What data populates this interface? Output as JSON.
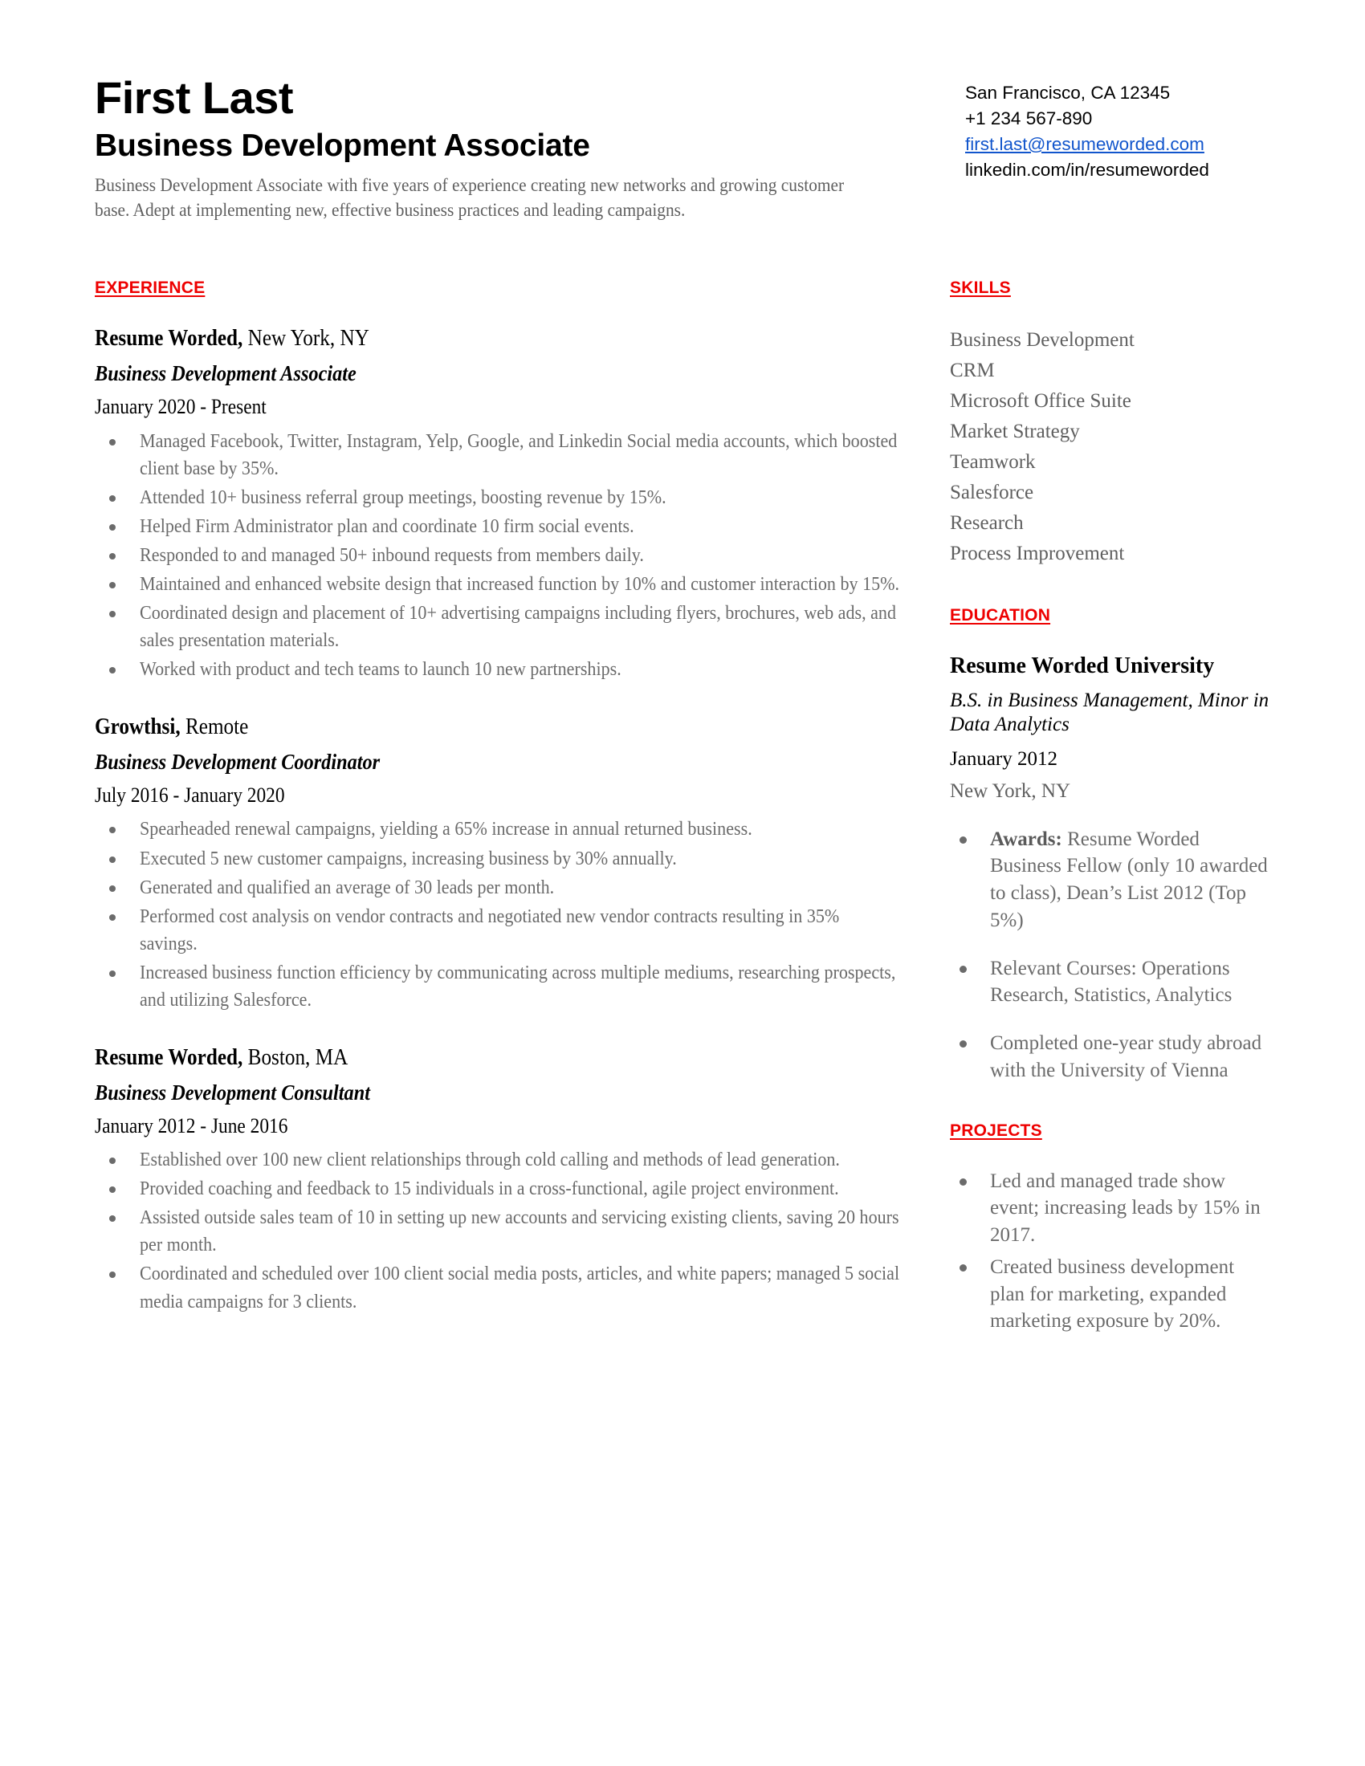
{
  "header": {
    "name": "First Last",
    "headline": "Business Development Associate",
    "summary": "Business Development Associate with five years of experience creating new networks and growing customer base. Adept at implementing new, effective business practices and leading campaigns.",
    "contact": {
      "location": "San Francisco, CA 12345",
      "phone": "+1 234 567-890",
      "email": "first.last@resumeworded.com",
      "linkedin": "linkedin.com/in/resumeworded"
    }
  },
  "colors": {
    "accent_red": "#ee0000",
    "link_blue": "#1155cc",
    "body_gray": "#6b6b6b"
  },
  "sections": {
    "experience_label": "EXPERIENCE",
    "skills_label": "SKILLS",
    "education_label": "EDUCATION",
    "projects_label": "PROJECTS"
  },
  "experience": [
    {
      "company": "Resume Worded,",
      "location": " New York, NY",
      "role": "Business Development Associate",
      "dates": "January 2020 - Present",
      "bullets": [
        "Managed Facebook, Twitter, Instagram, Yelp, Google, and Linkedin Social media accounts, which boosted client base by 35%.",
        "Attended 10+ business referral group meetings, boosting revenue by 15%.",
        "Helped Firm Administrator plan and coordinate 10 firm social events.",
        "Responded to and managed 50+ inbound requests from members daily.",
        "Maintained and enhanced website design that increased function by 10% and customer interaction by 15%.",
        "Coordinated design and placement of 10+ advertising campaigns including flyers, brochures, web ads, and sales presentation materials.",
        "Worked with product and tech teams to launch 10 new partnerships."
      ]
    },
    {
      "company": "Growthsi,",
      "location": " Remote",
      "role": "Business Development Coordinator",
      "dates": "July 2016 - January 2020",
      "bullets": [
        "Spearheaded renewal campaigns, yielding a 65% increase in annual returned business.",
        "Executed 5 new customer campaigns, increasing business by 30% annually.",
        "Generated and qualified an average of 30 leads per month.",
        "Performed cost analysis on vendor contracts and negotiated new vendor contracts resulting in 35% savings.",
        "Increased business function efficiency by communicating across multiple mediums, researching prospects, and utilizing Salesforce."
      ]
    },
    {
      "company": "Resume Worded,",
      "location": " Boston, MA",
      "role": "Business Development Consultant",
      "dates": "January 2012 - June 2016",
      "bullets": [
        "Established over 100 new client relationships through cold calling and methods of lead generation.",
        "Provided coaching and feedback to 15 individuals in a cross-functional, agile project environment.",
        "Assisted outside sales team of 10 in setting up new accounts and servicing existing clients, saving 20 hours per month.",
        "Coordinated and scheduled over 100 client social media posts, articles, and white papers; managed 5 social media campaigns for 3 clients."
      ]
    }
  ],
  "skills": [
    "Business Development",
    "CRM",
    "Microsoft Office Suite",
    "Market Strategy",
    "Teamwork",
    "Salesforce",
    "Research",
    "Process Improvement"
  ],
  "education": {
    "school": "Resume Worded University",
    "degree": "B.S. in Business Management, Minor in Data Analytics",
    "date": "January 2012",
    "location": "New York, NY",
    "bullets": [
      {
        "label": "Awards:",
        "text": " Resume Worded Business Fellow (only 10 awarded to class), Dean’s List 2012 (Top 5%)"
      },
      {
        "label": "",
        "text": "Relevant Courses: Operations Research, Statistics, Analytics"
      },
      {
        "label": "",
        "text": "Completed one-year study abroad with the University of Vienna"
      }
    ]
  },
  "projects": [
    "Led and managed trade show event; increasing leads by 15% in 2017.",
    "Created business development plan for marketing, expanded marketing exposure by 20%."
  ]
}
